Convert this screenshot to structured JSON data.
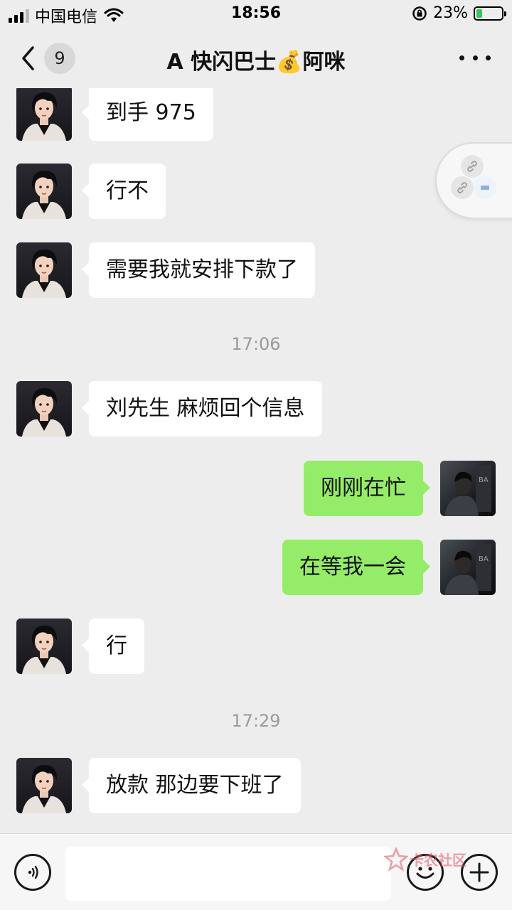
{
  "status_bar": {
    "carrier": "中国电信",
    "time": "18:56",
    "battery": "23%",
    "battery_level": 0.23,
    "icons": [
      "signal-icon",
      "wifi-icon",
      "orientation-lock-icon",
      "battery-icon"
    ]
  },
  "nav": {
    "unread_count": "9",
    "title": "A 快闪巴士💰阿咪"
  },
  "messages": [
    {
      "side": "left",
      "text": "到手 975"
    },
    {
      "side": "left",
      "text": "行不"
    },
    {
      "side": "left",
      "text": "需要我就安排下款了"
    },
    {
      "type": "time",
      "text": "17:06"
    },
    {
      "side": "left",
      "text": "刘先生 麻烦回个信息"
    },
    {
      "side": "right",
      "text": "刚刚在忙"
    },
    {
      "side": "right",
      "text": "在等我一会"
    },
    {
      "side": "left",
      "text": "行"
    },
    {
      "type": "time",
      "text": "17:29"
    },
    {
      "side": "left",
      "text": "放款 那边要下班了"
    }
  ],
  "input_bar": {
    "placeholder": "",
    "icons": [
      "voice-icon",
      "emoji-icon",
      "plus-icon"
    ]
  },
  "watermark": {
    "text": "卡农社区"
  },
  "colors": {
    "background": "#ededed",
    "bubble_self": "#95ec69",
    "bubble_other": "#ffffff",
    "timestamp": "#9a9a9a"
  }
}
